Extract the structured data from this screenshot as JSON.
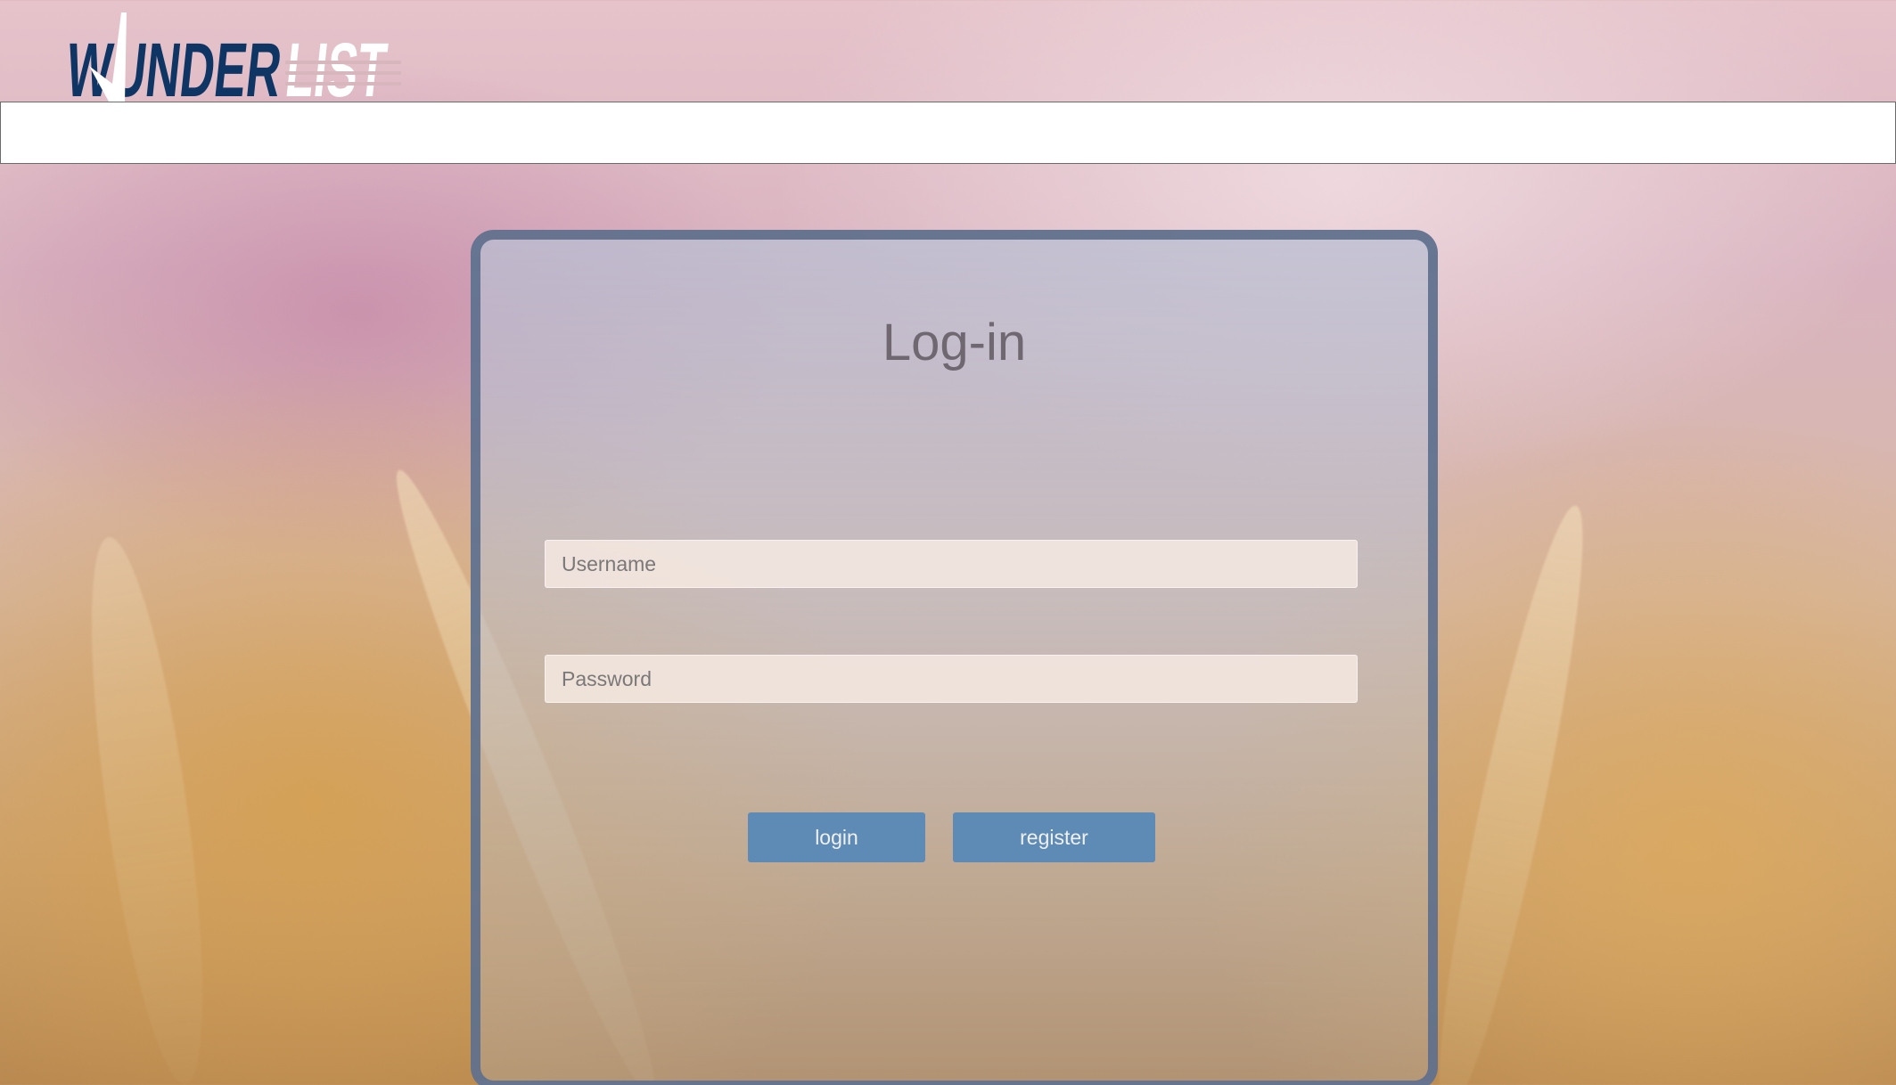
{
  "logo": {
    "text_primary": "WUNDER",
    "text_secondary": "LIST",
    "primary_color": "#0f3565",
    "secondary_color": "#ffffff"
  },
  "login": {
    "title": "Log-in",
    "username_placeholder": "Username",
    "password_placeholder": "Password",
    "login_label": "login",
    "register_label": "register"
  },
  "colors": {
    "button": "#5d8bb5",
    "card_border": "#5c6e8c",
    "title": "#6f6870"
  }
}
